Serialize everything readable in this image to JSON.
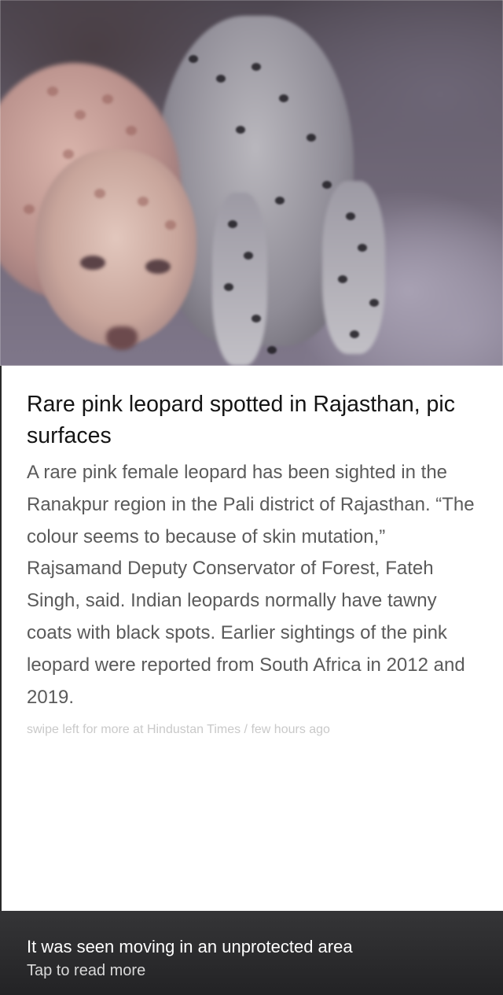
{
  "hero": {
    "alt": "pink-leopard-photo"
  },
  "article": {
    "headline": "Rare pink leopard spotted in Rajasthan, pic surfaces",
    "body": "A rare pink female leopard has been sighted in the Ranakpur region in the Pali district of Rajasthan. “The colour seems to because of skin mutation,” Rajsamand Deputy Conservator of Forest, Fateh Singh, said. Indian leopards normally have tawny coats with black spots. Earlier sightings of the pink leopard were reported from South Africa in 2012 and 2019.",
    "source": "swipe left for more at Hindustan Times / few hours ago"
  },
  "banner": {
    "title": "It was seen moving in an unprotected area",
    "cta": "Tap to read more"
  },
  "colors": {
    "headline": "#141414",
    "body": "#5a5a5a",
    "source": "#c9c9c9",
    "banner_bg": "#2c2c2e"
  }
}
